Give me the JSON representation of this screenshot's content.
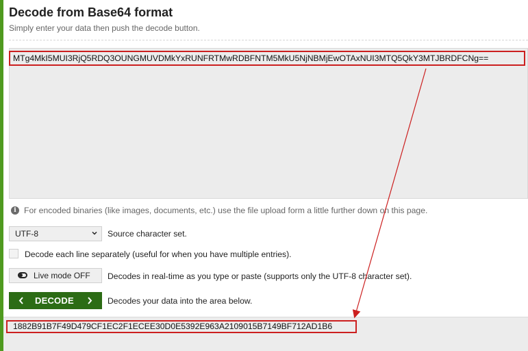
{
  "header": {
    "title": "Decode from Base64 format",
    "subtitle": "Simply enter your data then push the decode button."
  },
  "input": {
    "value": "MTg4MkI5MUI3RjQ5RDQ3OUNGMUVDMkYxRUNFRTMwRDBFNTM5MkU5NjNBMjEwOTAxNUI3MTQ5QkY3MTJBRDFCNg=="
  },
  "info": {
    "icon": "info-icon",
    "text": "For encoded binaries (like images, documents, etc.) use the file upload form a little further down on this page."
  },
  "charset": {
    "selected": "UTF-8",
    "label": "Source character set."
  },
  "line_by_line": {
    "checked": false,
    "label": "Decode each line separately (useful for when you have multiple entries)."
  },
  "live_mode": {
    "button_label": "Live mode OFF",
    "description": "Decodes in real-time as you type or paste (supports only the UTF-8 character set)."
  },
  "decode": {
    "button_label": "DECODE",
    "description": "Decodes your data into the area below."
  },
  "output": {
    "value": "1882B91B7F49D479CF1EC2F1ECEE30D0E5392E963A2109015B7149BF712AD1B6"
  },
  "colors": {
    "accent_green": "#2c6c15",
    "left_bar": "#4f9a1f",
    "highlight_red": "#cc1f1f"
  }
}
